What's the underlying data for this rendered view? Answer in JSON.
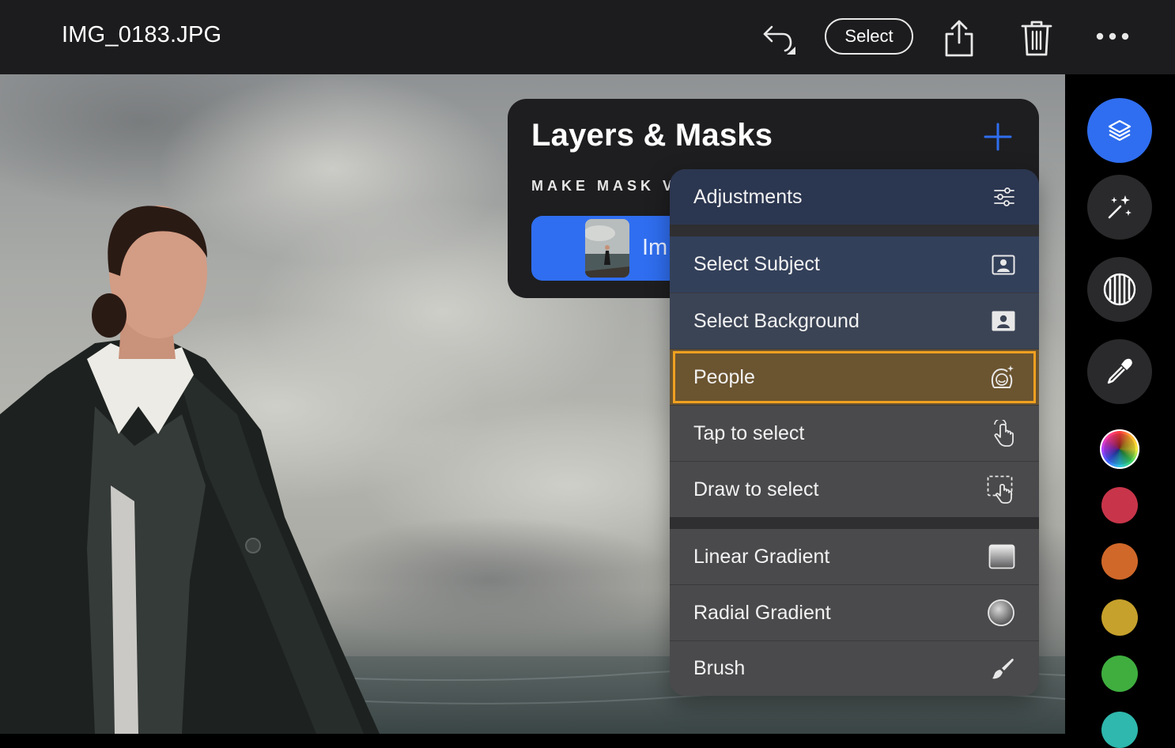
{
  "topbar": {
    "file_title": "IMG_0183.JPG",
    "select_label": "Select",
    "icons": [
      "undo-icon",
      "share-icon",
      "trash-icon",
      "more-icon"
    ]
  },
  "layers_panel": {
    "title": "Layers & Masks",
    "section_label": "MAKE MASK V",
    "layer_name": "Im",
    "add_icon": "plus-icon"
  },
  "menu": {
    "items": [
      {
        "label": "Adjustments",
        "icon": "sliders-icon"
      },
      {
        "label": "Select Subject",
        "icon": "subject-portrait-icon"
      },
      {
        "label": "Select Background",
        "icon": "background-portrait-icon"
      },
      {
        "label": "People",
        "icon": "people-face-icon",
        "highlighted": true
      },
      {
        "label": "Tap to select",
        "icon": "tap-hand-icon"
      },
      {
        "label": "Draw to select",
        "icon": "draw-select-icon"
      },
      {
        "label": "Linear Gradient",
        "icon": "linear-gradient-icon"
      },
      {
        "label": "Radial Gradient",
        "icon": "radial-gradient-icon"
      },
      {
        "label": "Brush",
        "icon": "brush-icon"
      }
    ]
  },
  "sidebar": {
    "tools": [
      "layers-icon",
      "magic-wand-icon",
      "stripes-mask-icon",
      "eyedropper-icon",
      "color-wheel-icon"
    ],
    "swatches": [
      "#c8354a",
      "#d0682a",
      "#c6a12c",
      "#3fae3f",
      "#2fb8ad"
    ]
  },
  "colors": {
    "accent": "#2f6ef0",
    "highlight_border": "#f0a020",
    "topbar_bg": "#1c1c1e"
  }
}
